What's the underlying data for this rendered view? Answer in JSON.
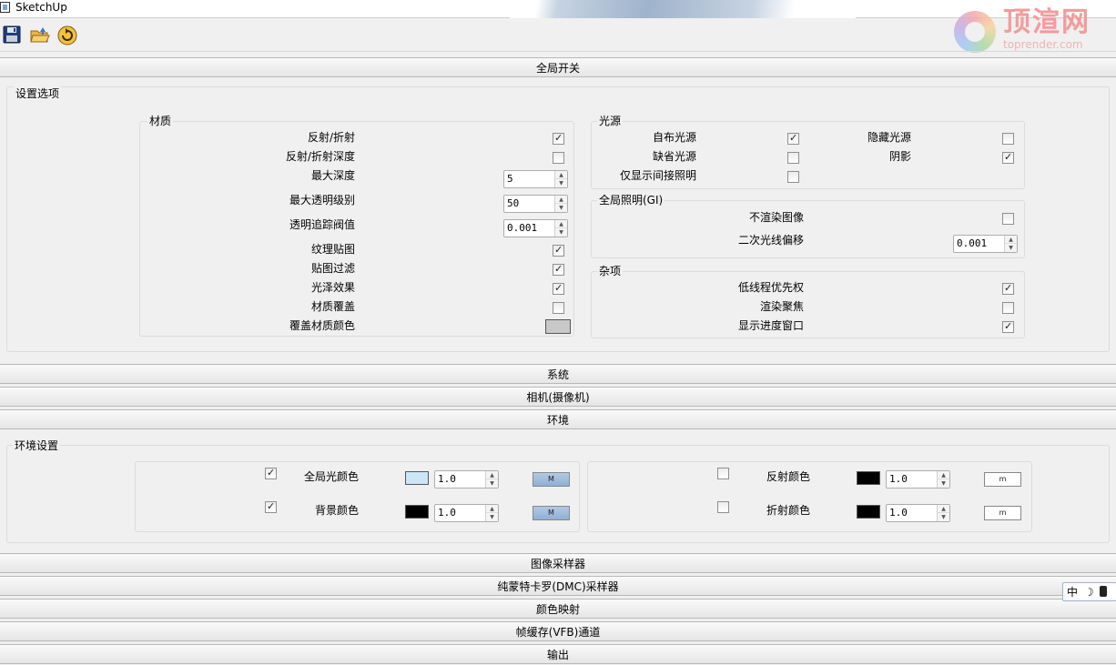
{
  "window": {
    "title": "SketchUp"
  },
  "logo": {
    "text": "顶渲网",
    "url": "toprender.com"
  },
  "toolbar": {
    "save_icon": "save-icon",
    "open_icon": "open-folder-icon",
    "refresh_icon": "refresh-icon"
  },
  "sections": {
    "global_switches": "全局开关",
    "system": "系统",
    "camera": "相机(摄像机)",
    "environment": "环境",
    "image_sampler": "图像采样器",
    "dmc_sampler": "纯蒙特卡罗(DMC)采样器",
    "color_mapping": "颜色映射",
    "vfb_channels": "帧缓存(VFB)通道",
    "output": "输出"
  },
  "settings": {
    "title": "设置选项",
    "materials": {
      "title": "材质",
      "reflection_refraction": {
        "label": "反射/折射",
        "checked": true
      },
      "refl_refr_depth": {
        "label": "反射/折射深度",
        "checked": false
      },
      "max_depth": {
        "label": "最大深度",
        "value": "5"
      },
      "max_transp_levels": {
        "label": "最大透明级别",
        "value": "50"
      },
      "transp_cutoff": {
        "label": "透明追踪阀值",
        "value": "0.001"
      },
      "texture_maps": {
        "label": "纹理贴图",
        "checked": true
      },
      "filter_maps": {
        "label": "贴图过滤",
        "checked": true
      },
      "glossy_effects": {
        "label": "光泽效果",
        "checked": true
      },
      "override_materials": {
        "label": "材质覆盖",
        "checked": false
      },
      "override_color": {
        "label": "覆盖材质颜色",
        "color": "#c8c8c8"
      }
    },
    "lights": {
      "title": "光源",
      "lights": {
        "label": "自布光源",
        "checked": true
      },
      "hidden_lights": {
        "label": "隐藏光源",
        "checked": false
      },
      "default_lights": {
        "label": "缺省光源",
        "checked": false
      },
      "shadows": {
        "label": "阴影",
        "checked": true
      },
      "gi_only": {
        "label": "仅显示间接照明",
        "checked": false
      }
    },
    "gi": {
      "title": "全局照明(GI)",
      "dont_render_image": {
        "label": "不渲染图像",
        "checked": false
      },
      "secondary_ray_bias": {
        "label": "二次光线偏移",
        "value": "0.001"
      }
    },
    "misc": {
      "title": "杂项",
      "low_thread_priority": {
        "label": "低线程优先权",
        "checked": true
      },
      "render_focus": {
        "label": "渲染聚焦",
        "checked": false
      },
      "show_progress": {
        "label": "显示进度窗口",
        "checked": true
      }
    }
  },
  "environment": {
    "title": "环境设置",
    "gi_color": {
      "label": "全局光颜色",
      "checked": true,
      "value": "1.0",
      "color": "#cde6f7",
      "map_label": "M"
    },
    "background_color": {
      "label": "背景颜色",
      "checked": true,
      "value": "1.0",
      "color": "#000000",
      "map_label": "M"
    },
    "reflection_color": {
      "label": "反射颜色",
      "checked": false,
      "value": "1.0",
      "color": "#000000",
      "map_label": "m"
    },
    "refraction_color": {
      "label": "折射颜色",
      "checked": false,
      "value": "1.0",
      "color": "#000000",
      "map_label": "m"
    }
  },
  "ime": {
    "mode": "中",
    "moon": "☽",
    "icon": "ime-settings-icon"
  }
}
